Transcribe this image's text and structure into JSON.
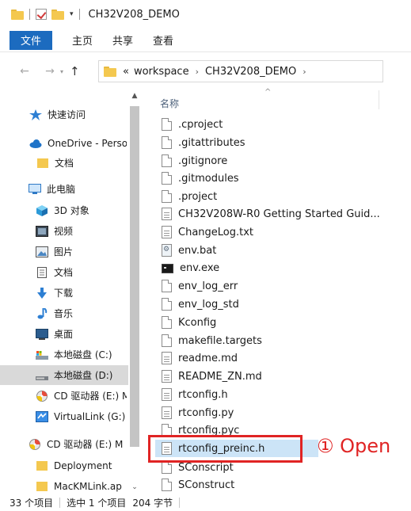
{
  "window": {
    "title": "CH32V208_DEMO",
    "qa_dropdown": "▾"
  },
  "ribbon": {
    "file_tab": "文件",
    "tabs": [
      "主页",
      "共享",
      "查看"
    ]
  },
  "address": {
    "back": "←",
    "forward": "→",
    "recent_dropdown": "▾",
    "up": "↑",
    "overflow": "«",
    "crumbs": [
      "workspace",
      "CH32V208_DEMO"
    ],
    "separator": "›"
  },
  "nav": {
    "items": [
      {
        "label": "快速访问",
        "icon": "pin-star-icon"
      },
      {
        "label": "OneDrive - Perso",
        "icon": "cloud-icon"
      },
      {
        "label": "文档",
        "icon": "folder-icon"
      },
      {
        "label": "此电脑",
        "icon": "computer-icon"
      },
      {
        "label": "3D 对象",
        "icon": "cube-3d-icon"
      },
      {
        "label": "视频",
        "icon": "video-icon"
      },
      {
        "label": "图片",
        "icon": "picture-icon"
      },
      {
        "label": "文档",
        "icon": "documents-icon"
      },
      {
        "label": "下载",
        "icon": "download-icon"
      },
      {
        "label": "音乐",
        "icon": "music-icon"
      },
      {
        "label": "桌面",
        "icon": "desktop-icon"
      },
      {
        "label": "本地磁盘 (C:)",
        "icon": "drive-c-icon"
      },
      {
        "label": "本地磁盘 (D:)",
        "icon": "drive-d-icon",
        "selected": true
      },
      {
        "label": "CD 驱动器 (E:) M",
        "icon": "cd-drive-icon"
      },
      {
        "label": "VirtualLink (G:)",
        "icon": "network-drive-icon"
      },
      {
        "label": "CD 驱动器 (E:) M",
        "icon": "cd-drive-icon"
      },
      {
        "label": "Deployment",
        "icon": "folder-icon"
      },
      {
        "label": "MacKMLink.ap",
        "icon": "folder-icon"
      }
    ]
  },
  "scroll": {
    "up": "▲",
    "down": "⌄"
  },
  "list": {
    "header_name": "名称",
    "sort_indicator": "^",
    "files": [
      {
        "name": ".cproject",
        "icon": "blank-file-icon"
      },
      {
        "name": ".gitattributes",
        "icon": "blank-file-icon"
      },
      {
        "name": ".gitignore",
        "icon": "blank-file-icon"
      },
      {
        "name": ".gitmodules",
        "icon": "blank-file-icon"
      },
      {
        "name": ".project",
        "icon": "blank-file-icon"
      },
      {
        "name": "CH32V208W-R0 Getting Started Guid...",
        "icon": "text-file-icon"
      },
      {
        "name": "ChangeLog.txt",
        "icon": "text-file-icon"
      },
      {
        "name": "env.bat",
        "icon": "batch-file-icon"
      },
      {
        "name": "env.exe",
        "icon": "console-exe-icon"
      },
      {
        "name": "env_log_err",
        "icon": "blank-file-icon"
      },
      {
        "name": "env_log_std",
        "icon": "blank-file-icon"
      },
      {
        "name": "Kconfig",
        "icon": "blank-file-icon"
      },
      {
        "name": "makefile.targets",
        "icon": "blank-file-icon"
      },
      {
        "name": "readme.md",
        "icon": "text-file-icon"
      },
      {
        "name": "README_ZN.md",
        "icon": "text-file-icon"
      },
      {
        "name": "rtconfig.h",
        "icon": "text-file-icon"
      },
      {
        "name": "rtconfig.py",
        "icon": "text-file-icon"
      },
      {
        "name": "rtconfig.pyc",
        "icon": "blank-file-icon"
      },
      {
        "name": "rtconfig_preinc.h",
        "icon": "text-file-icon",
        "selected": true
      },
      {
        "name": "SConscript",
        "icon": "blank-file-icon"
      },
      {
        "name": "SConstruct",
        "icon": "blank-file-icon"
      }
    ]
  },
  "annotation": {
    "label": "① Open",
    "color": "#e02424"
  },
  "status": {
    "count": "33 个项目",
    "selection": "选中 1 个项目",
    "size": "204 字节"
  },
  "colors": {
    "accent": "#1c6bbf",
    "selection": "#cce4f7",
    "nav_selection": "#d9d9d9",
    "annotation": "#e02424"
  }
}
